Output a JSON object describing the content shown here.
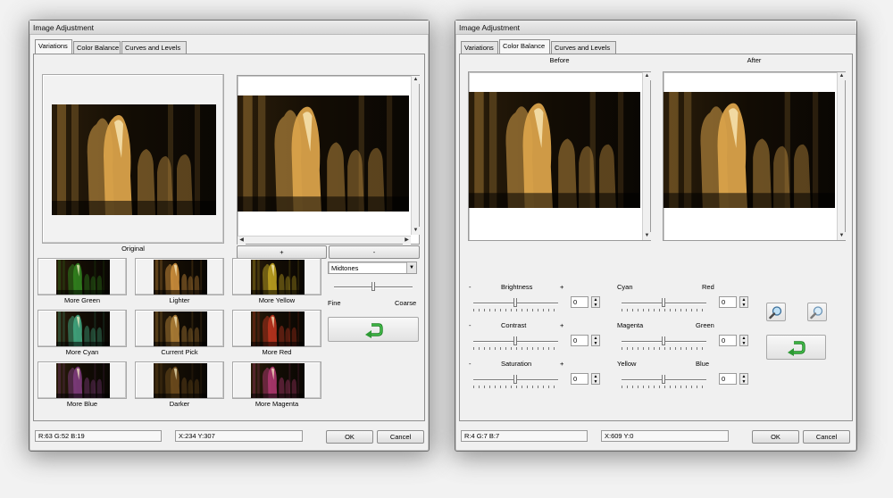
{
  "left_window": {
    "title": "Image Adjustment",
    "tabs": [
      {
        "label": "Variations",
        "active": true
      },
      {
        "label": "Color Balance",
        "active": false
      },
      {
        "label": "Curves and Levels",
        "active": false
      }
    ],
    "original_label": "Original",
    "plus_label": "+",
    "minus_label": "-",
    "range_select": "Midtones",
    "fine_label": "Fine",
    "coarse_label": "Coarse",
    "fine_coarse_level": 0.5,
    "variations": [
      {
        "label": "More Green",
        "tint": "#2f7d1d"
      },
      {
        "label": "Lighter",
        "tint": "#c68a3a"
      },
      {
        "label": "More Yellow",
        "tint": "#b59a1f"
      },
      {
        "label": "More Cyan",
        "tint": "#3fa07a"
      },
      {
        "label": "Current Pick",
        "tint": "#a87a35"
      },
      {
        "label": "More Red",
        "tint": "#b3331e"
      },
      {
        "label": "More Blue",
        "tint": "#7a3a78"
      },
      {
        "label": "Darker",
        "tint": "#6a4a1c"
      },
      {
        "label": "More Magenta",
        "tint": "#a8366a"
      }
    ],
    "status_rgb": "R:63 G:52 B:19",
    "status_xy": "X:234 Y:307",
    "ok_label": "OK",
    "cancel_label": "Cancel"
  },
  "right_window": {
    "title": "Image Adjustment",
    "tabs": [
      {
        "label": "Variations",
        "active": false
      },
      {
        "label": "Color Balance",
        "active": true
      },
      {
        "label": "Curves and Levels",
        "active": false
      }
    ],
    "before_label": "Before",
    "after_label": "After",
    "sliders_left": [
      {
        "minus": "-",
        "name": "Brightness",
        "plus": "+",
        "value": "0"
      },
      {
        "minus": "-",
        "name": "Contrast",
        "plus": "+",
        "value": "0"
      },
      {
        "minus": "-",
        "name": "Saturation",
        "plus": "+",
        "value": "0"
      }
    ],
    "sliders_right": [
      {
        "left": "Cyan",
        "right": "Red",
        "value": "0"
      },
      {
        "left": "Magenta",
        "right": "Green",
        "value": "0"
      },
      {
        "left": "Yellow",
        "right": "Blue",
        "value": "0"
      }
    ],
    "status_rgb": "R:4 G:7 B:7",
    "status_xy": "X:609 Y:0",
    "ok_label": "OK",
    "cancel_label": "Cancel"
  },
  "colors": {
    "accent_arrow": "#2d9a34",
    "photo_warm": "#d9a24a"
  }
}
